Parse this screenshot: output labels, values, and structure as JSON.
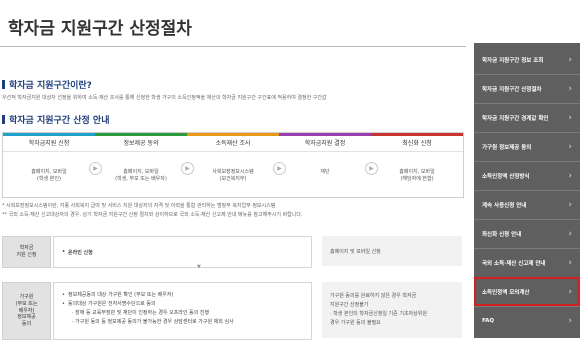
{
  "page": {
    "title": "학자금 지원구간 산정절차",
    "section1_title": "학자금 지원구간이란?",
    "section1_desc": "우선적 학자금지원 대상자 선정을 위하여 소득·재산 조사를 통해 신청한 학생 가구의 소득인정액을 재산의 학자금 지원구간 구간표에 적용하여 결정한 구간값",
    "section2_title": "학자금 지원구간 산정 안내"
  },
  "steps": [
    {
      "head": "학자금지원 신청",
      "line1": "홈페이지, 모바일",
      "line2": "(학생 본인)",
      "color": "#1fa2c9"
    },
    {
      "head": "정보제공 동의",
      "line1": "홈페이지, 모바일",
      "line2": "(학생, 부모 또는 배우자)",
      "color": "#2c9b3e"
    },
    {
      "head": "소득재산 조사",
      "line1": "사회보장정보시스템",
      "line2": "(보건복지부)",
      "color": "#e89b1a"
    },
    {
      "head": "학자금지원 결정",
      "line1": "재단",
      "line2": "",
      "color": "#9a3fb1"
    },
    {
      "head": "최신화 신청",
      "line1": "홈페이지, 모바일",
      "line2": "(해당자에 한함)",
      "color": "#c8342e"
    }
  ],
  "notes": [
    "* 사회보장정보시스템이란, 각종 사회복지 급여 및 서비스 지원 대상자의 자격 및 이력을 통합 관리하는 범정부 복지업무 정보시스템",
    "** 국외 소득·재산 신고대상자의 경우, 상기 학자금 지원구간 산정 절차와 상이하므로 국외 소득·재산 신고제 안내 메뉴를 참고해주시기 바랍니다."
  ],
  "table": {
    "row1_label": "학자금\n지원 신청",
    "row1_content": "온라인 신청",
    "row1_right": "홈페이지 및 모바일 신청",
    "row2_label": "가구원\n(부모 또는\n배우자)\n정보제공\n동의",
    "row2_items": [
      "정보제공동의 대상 가구원 확인 (부모 또는 배우자)",
      "동의대상 가구원은 전자서명수단으로 동의",
      "· 장애 등 교육부장관 및 재단이 인정하는 경우 오프라인 동의 진행",
      "· 가구원 동의 등 정보제공 동의가 불가능한 경우 상담센터로 가구원 제외 심사"
    ],
    "row2_right": [
      "가구원 동의를 완료하지 않은 경우 학자금",
      "지원구간 산정불가",
      "· 학생 본인의 학자금신청일 기준 기초자상위원",
      "  경우 가구원 동의 불필요"
    ],
    "down_arrow": "▼"
  },
  "sidebar": {
    "items": [
      {
        "label": "학자금 지원구간 정보 조회"
      },
      {
        "label": "학자금 지원구간 산정절차"
      },
      {
        "label": "학자금 지원구간 경계값 확인"
      },
      {
        "label": "가구원 정보제공 동의"
      },
      {
        "label": "소득인정액 산정방식"
      },
      {
        "label": "계속 사용신청 안내"
      },
      {
        "label": "최신화 신청 안내"
      },
      {
        "label": "국외 소득·재산 신고제 안내"
      },
      {
        "label": "소득인정액 모의계산"
      },
      {
        "label": "FAQ"
      }
    ],
    "highlight_color": "#d21f1f"
  }
}
